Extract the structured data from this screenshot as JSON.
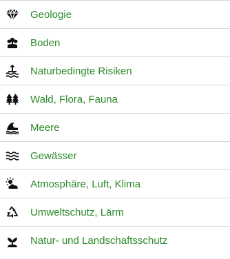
{
  "menu": {
    "items": [
      {
        "label": "Geologie",
        "icon": "gem-icon"
      },
      {
        "label": "Boden",
        "icon": "plant-sprout-icon"
      },
      {
        "label": "Naturbedingte Risiken",
        "icon": "flood-risk-icon"
      },
      {
        "label": "Wald, Flora, Fauna",
        "icon": "trees-icon"
      },
      {
        "label": "Meere",
        "icon": "wave-icon"
      },
      {
        "label": "Gewässer",
        "icon": "water-icon"
      },
      {
        "label": "Atmosphäre, Luft, Klima",
        "icon": "weather-icon"
      },
      {
        "label": "Umweltschutz, Lärm",
        "icon": "recycle-icon"
      },
      {
        "label": "Natur- und Landschaftsschutz",
        "icon": "nature-protection-icon"
      }
    ]
  },
  "colors": {
    "link": "#2a8a2a",
    "icon": "#111111",
    "divider": "#d7d7d7"
  }
}
